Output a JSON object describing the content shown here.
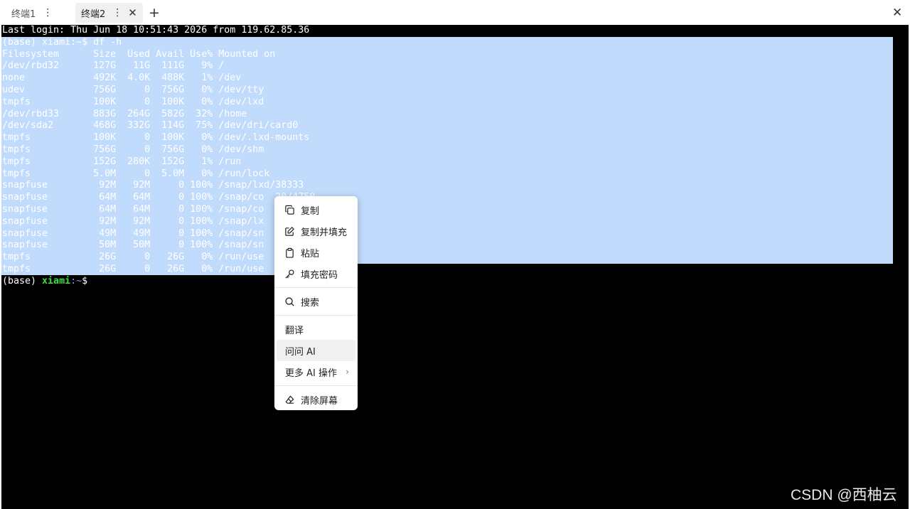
{
  "tabs": [
    {
      "label": "终端1"
    },
    {
      "label": "终端2"
    }
  ],
  "icons": {
    "tab_more": "⋮",
    "tab_close": "✕",
    "add_tab": "+",
    "window_close": "✕",
    "submenu_chevron": "›"
  },
  "terminal": {
    "last_login": "Last login: Thu Jun 18 10:51:43 2026 from 119.62.85.36",
    "command_prompt": {
      "env": "(base) ",
      "user": "xiami",
      "path": ":~",
      "dollar": "$ ",
      "command": "df -h"
    },
    "df_header": "Filesystem      Size  Used Avail Use% Mounted on",
    "df_rows": [
      "/dev/rbd32      127G   11G  111G   9% /",
      "none            492K  4.0K  488K   1% /dev",
      "udev            756G     0  756G   0% /dev/tty",
      "tmpfs           100K     0  100K   0% /dev/lxd",
      "/dev/rbd33      883G  264G  582G  32% /home",
      "/dev/sda2       468G  332G  114G  75% /dev/dri/card0",
      "tmpfs           100K     0  100K   0% /dev/.lxd-mounts",
      "tmpfs           756G     0  756G   0% /dev/shm",
      "tmpfs           152G  280K  152G   1% /run",
      "tmpfs           5.0M     0  5.0M   0% /run/lock",
      "snapfuse         92M   92M     0 100% /snap/lxd/38333",
      "snapfuse         64M   64M     0 100% /snap/co  20/4750",
      "snapfuse         64M   64M     0 100% /snap/co",
      "snapfuse         92M   92M     0 100% /snap/lx",
      "snapfuse         49M   49M     0 100% /snap/sn",
      "snapfuse         50M   50M     0 100% /snap/sn",
      "tmpfs            26G     0   26G   0% /run/use",
      "tmpfs            26G     0   26G   0% /run/use"
    ],
    "final_prompt": {
      "env": "(base) ",
      "user": "xiami",
      "path": ":~",
      "dollar": "$"
    }
  },
  "context_menu": {
    "items": [
      {
        "label": "复制",
        "icon": "copy-icon"
      },
      {
        "label": "复制并填充",
        "icon": "edit-icon"
      },
      {
        "label": "粘贴",
        "icon": "clipboard-icon"
      },
      {
        "label": "填充密码",
        "icon": "key-icon"
      },
      {
        "label": "搜索",
        "icon": "search-icon"
      },
      {
        "label": "翻译"
      },
      {
        "label": "问问 AI"
      },
      {
        "label": "更多 AI 操作"
      },
      {
        "label": "清除屏幕",
        "icon": "eraser-icon"
      }
    ]
  },
  "watermark": "CSDN @西柚云",
  "colors": {
    "terminal_bg": "#000000",
    "selection": "#c0dbfc",
    "prompt_user": "#4ee44e",
    "prompt_path": "#6f8cff"
  }
}
